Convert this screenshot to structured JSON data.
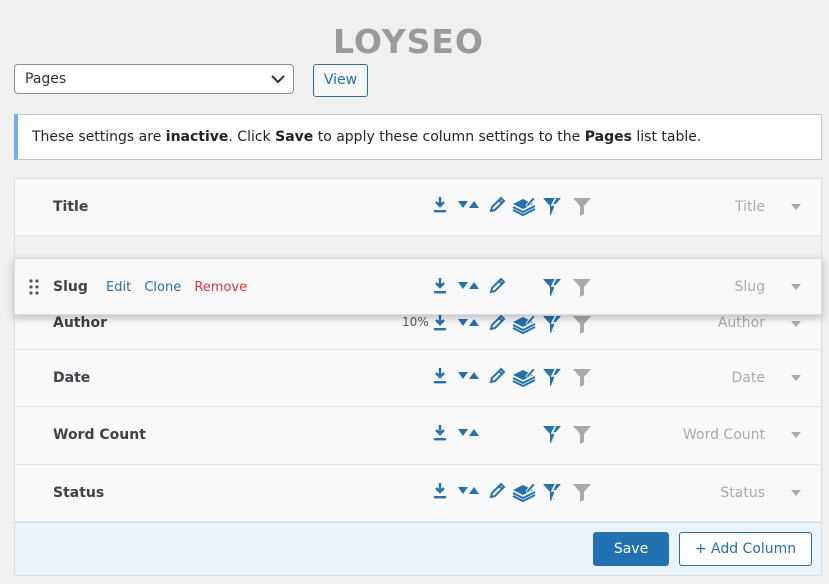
{
  "logo": {
    "text": "LOYSEO"
  },
  "select": {
    "value": "Pages"
  },
  "view_label": "View",
  "notice": {
    "part1": "These settings are ",
    "inactive": "inactive",
    "part2": ". Click ",
    "save": "Save",
    "part3": " to apply these column settings to the ",
    "pages": "Pages",
    "part4": " list table."
  },
  "rows": {
    "title": {
      "label": "Title",
      "type": "Title"
    },
    "slug": {
      "label": "Slug",
      "type": "Slug",
      "edit": "Edit",
      "clone": "Clone",
      "remove": "Remove"
    },
    "author": {
      "label": "Author",
      "type": "Author",
      "percent": "10%"
    },
    "date": {
      "label": "Date",
      "type": "Date"
    },
    "word_count": {
      "label": "Word Count",
      "type": "Word Count"
    },
    "status": {
      "label": "Status",
      "type": "Status"
    }
  },
  "footer": {
    "save_label": "Save",
    "add_column_label": "+ Add Column"
  },
  "colors": {
    "accent": "#2271b1",
    "remove": "#d63638",
    "notice_border": "#72aee6",
    "muted_icon": "#a7aaad"
  }
}
